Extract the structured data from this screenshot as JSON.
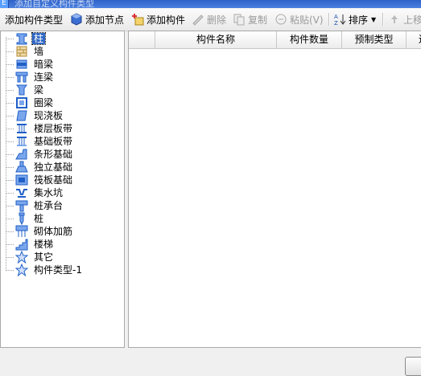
{
  "window": {
    "title": "添加自定义构件类型"
  },
  "toolbar": {
    "add_type": "添加构件类型",
    "add_node": "添加节点",
    "add_component": "添加构件",
    "delete": "删除",
    "copy": "复制",
    "paste": "粘贴(V)",
    "sort": "排序",
    "move_up": "上移"
  },
  "tree": {
    "items": [
      {
        "label": "柱",
        "icon": "column-icon",
        "selected": true
      },
      {
        "label": "墙",
        "icon": "wall-icon"
      },
      {
        "label": "暗梁",
        "icon": "hidden-beam-icon"
      },
      {
        "label": "连梁",
        "icon": "coupling-beam-icon"
      },
      {
        "label": "梁",
        "icon": "beam-icon"
      },
      {
        "label": "圈梁",
        "icon": "ring-beam-icon"
      },
      {
        "label": "现浇板",
        "icon": "slab-icon"
      },
      {
        "label": "楼层板带",
        "icon": "floor-strip-icon"
      },
      {
        "label": "基础板带",
        "icon": "foundation-strip-icon"
      },
      {
        "label": "条形基础",
        "icon": "strip-foundation-icon"
      },
      {
        "label": "独立基础",
        "icon": "isolated-foundation-icon"
      },
      {
        "label": "筏板基础",
        "icon": "raft-foundation-icon"
      },
      {
        "label": "集水坑",
        "icon": "sump-icon"
      },
      {
        "label": "桩承台",
        "icon": "pile-cap-icon"
      },
      {
        "label": "桩",
        "icon": "pile-icon"
      },
      {
        "label": "砌体加筋",
        "icon": "masonry-rebar-icon"
      },
      {
        "label": "楼梯",
        "icon": "stairs-icon"
      },
      {
        "label": "其它",
        "icon": "star-icon"
      },
      {
        "label": "构件类型-1",
        "icon": "star-icon"
      }
    ]
  },
  "grid": {
    "columns": [
      "构件名称",
      "构件数量",
      "预制类型",
      "连"
    ]
  }
}
